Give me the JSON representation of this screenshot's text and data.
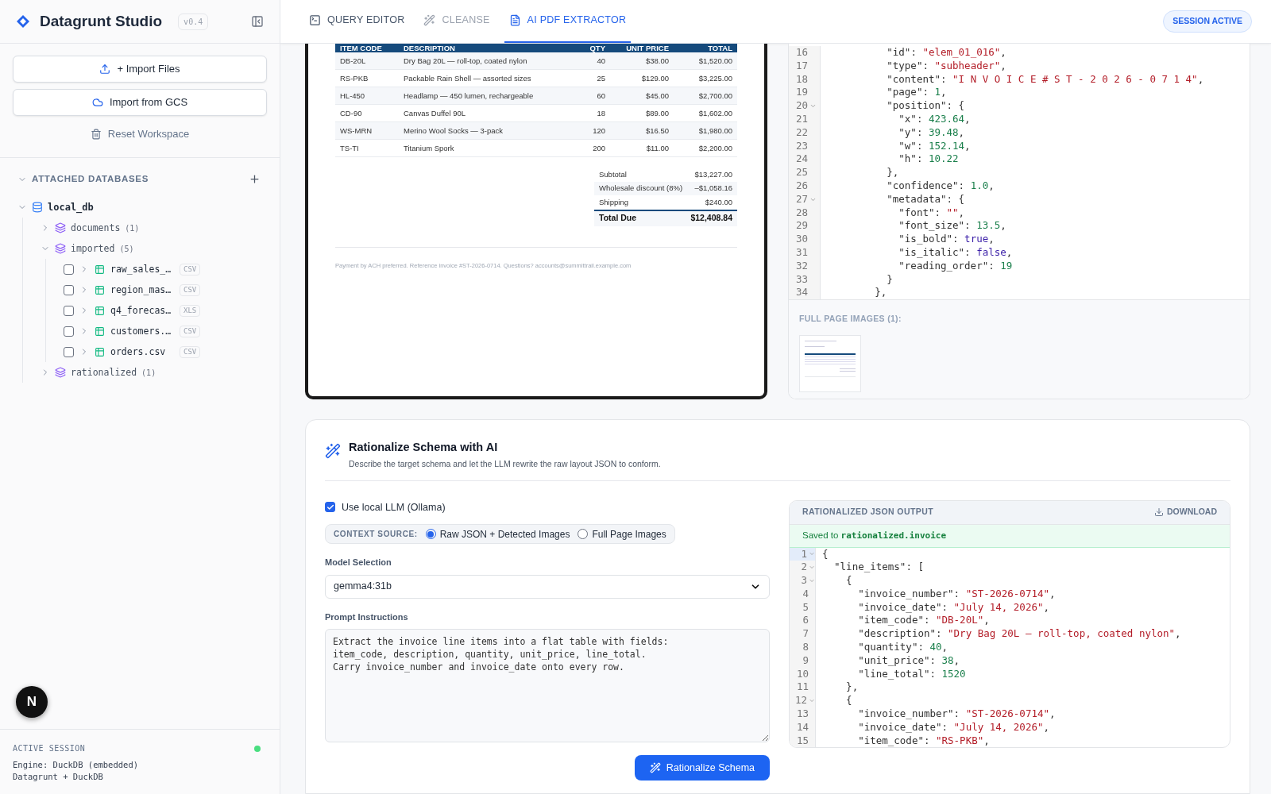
{
  "sidebar": {
    "brand": "Datagrunt Studio",
    "version": "v0.4",
    "actions": [
      {
        "kind": "primary",
        "label": "+ Import Files"
      },
      {
        "kind": "primary",
        "label": "Import from GCS"
      },
      {
        "kind": "plain",
        "label": "Reset Workspace"
      }
    ],
    "databases_title": "ATTACHED DATABASES",
    "databases_expanded": true,
    "tree": [
      {
        "kind": "database",
        "name": "local_db",
        "expanded": true,
        "children": [
          {
            "kind": "schema",
            "name": "documents",
            "count": "(1)",
            "expanded": false
          },
          {
            "kind": "schema",
            "name": "imported",
            "count": "(5)",
            "expanded": true,
            "children": [
              {
                "kind": "table",
                "name": "raw_sales_…",
                "badge": "CSV",
                "checked": false,
                "expanded": false
              },
              {
                "kind": "table",
                "name": "region_mas…",
                "badge": "CSV",
                "checked": false,
                "expanded": false
              },
              {
                "kind": "table",
                "name": "q4_forecas…",
                "badge": "XLS",
                "checked": false,
                "expanded": false
              },
              {
                "kind": "table",
                "name": "customers.…",
                "badge": "CSV",
                "checked": false,
                "expanded": false
              },
              {
                "kind": "table",
                "name": "orders.csv",
                "badge": "CSV",
                "checked": false,
                "expanded": false
              }
            ]
          },
          {
            "kind": "schema",
            "name": "rationalized",
            "count": "(1)",
            "expanded": false
          }
        ]
      }
    ],
    "footer": {
      "title": "ACTIVE SESSION",
      "online": true,
      "lines": [
        "Engine: DuckDB (embedded)",
        "Datagrunt + DuckDB"
      ]
    },
    "overlay_badge": "N"
  },
  "tabs": [
    {
      "label": "QUERY EDITOR",
      "kind": "terminal",
      "selected": false,
      "disabled": false
    },
    {
      "label": "CLEANSE",
      "kind": "wand",
      "selected": false,
      "disabled": true
    },
    {
      "label": "AI PDF EXTRACTOR",
      "kind": "document",
      "selected": true,
      "disabled": false
    }
  ],
  "session_badge": "SESSION ACTIVE",
  "pdf": {
    "columns": [
      "ITEM CODE",
      "DESCRIPTION",
      "QTY",
      "UNIT PRICE",
      "TOTAL"
    ],
    "rows": [
      [
        "DB-20L",
        "Dry Bag 20L — roll-top, coated nylon",
        "40",
        "$38.00",
        "$1,520.00"
      ],
      [
        "RS-PKB",
        "Packable Rain Shell — assorted sizes",
        "25",
        "$129.00",
        "$3,225.00"
      ],
      [
        "HL-450",
        "Headlamp — 450 lumen, rechargeable",
        "60",
        "$45.00",
        "$2,700.00"
      ],
      [
        "CD-90",
        "Canvas Duffel 90L",
        "18",
        "$89.00",
        "$1,602.00"
      ],
      [
        "WS-MRN",
        "Merino Wool Socks — 3-pack",
        "120",
        "$16.50",
        "$1,980.00"
      ],
      [
        "TS-TI",
        "Titanium Spork",
        "200",
        "$11.00",
        "$2,200.00"
      ]
    ],
    "totals": [
      {
        "label": "Subtotal",
        "value": "$13,227.00",
        "kind": "line"
      },
      {
        "label": "Wholesale discount (8%)",
        "value": "–$1,058.16",
        "kind": "line"
      },
      {
        "label": "Shipping",
        "value": "$240.00",
        "kind": "line"
      },
      {
        "label": "Total Due",
        "value": "$12,408.84",
        "kind": "total"
      }
    ],
    "note": "Payment by ACH preferred. Reference invoice #ST-2026-0714. Questions? accounts@summittrail.example.com"
  },
  "raw_json": {
    "lines": [
      {
        "n": "16",
        "fold": false,
        "text": "          \"id\": \"elem_01_016\","
      },
      {
        "n": "17",
        "fold": false,
        "text": "          \"type\": \"subheader\","
      },
      {
        "n": "18",
        "fold": false,
        "text": "          \"content\": \"I N V O I C E # S T - 2 0 2 6 - 0 7 1 4\","
      },
      {
        "n": "19",
        "fold": false,
        "text": "          \"page\": 1,"
      },
      {
        "n": "20",
        "fold": true,
        "text": "          \"position\": {"
      },
      {
        "n": "21",
        "fold": false,
        "text": "            \"x\": 423.64,"
      },
      {
        "n": "22",
        "fold": false,
        "text": "            \"y\": 39.48,"
      },
      {
        "n": "23",
        "fold": false,
        "text": "            \"w\": 152.14,"
      },
      {
        "n": "24",
        "fold": false,
        "text": "            \"h\": 10.22"
      },
      {
        "n": "25",
        "fold": false,
        "text": "          },"
      },
      {
        "n": "26",
        "fold": false,
        "text": "          \"confidence\": 1.0,"
      },
      {
        "n": "27",
        "fold": true,
        "text": "          \"metadata\": {"
      },
      {
        "n": "28",
        "fold": false,
        "text": "            \"font\": \"\","
      },
      {
        "n": "29",
        "fold": false,
        "text": "            \"font_size\": 13.5,"
      },
      {
        "n": "30",
        "fold": false,
        "text": "            \"is_bold\": true,"
      },
      {
        "n": "31",
        "fold": false,
        "text": "            \"is_italic\": false,"
      },
      {
        "n": "32",
        "fold": false,
        "text": "            \"reading_order\": 19"
      },
      {
        "n": "33",
        "fold": false,
        "text": "          }"
      },
      {
        "n": "34",
        "fold": false,
        "text": "        },"
      }
    ],
    "images_title": "FULL PAGE IMAGES (1):"
  },
  "rationalize": {
    "title": "Rationalize Schema with AI",
    "subtitle": "Describe the target schema and let the LLM rewrite the raw layout JSON to conform.",
    "use_local": {
      "label": "Use local LLM (Ollama)",
      "checked": true
    },
    "context_label": "CONTEXT SOURCE:",
    "context_options": [
      {
        "label": "Raw JSON + Detected Images",
        "selected": true
      },
      {
        "label": "Full Page Images",
        "selected": false
      }
    ],
    "model_label": "Model Selection",
    "model_value": "gemma4:31b",
    "prompt_label": "Prompt Instructions",
    "prompt_value": "Extract the invoice line items into a flat table with fields:\nitem_code, description, quantity, unit_price, line_total.\nCarry invoice_number and invoice_date onto every row.",
    "button": "Rationalize Schema",
    "output": {
      "title": "RATIONALIZED JSON OUTPUT",
      "download": "DOWNLOAD",
      "saved_prefix": "Saved to",
      "saved_target": "rationalized.invoice",
      "lines": [
        {
          "n": "1",
          "fold": true,
          "active": true,
          "text": "{"
        },
        {
          "n": "2",
          "fold": true,
          "active": false,
          "text": "  \"line_items\": ["
        },
        {
          "n": "3",
          "fold": true,
          "active": false,
          "text": "    {"
        },
        {
          "n": "4",
          "fold": false,
          "active": false,
          "text": "      \"invoice_number\": \"ST-2026-0714\","
        },
        {
          "n": "5",
          "fold": false,
          "active": false,
          "text": "      \"invoice_date\": \"July 14, 2026\","
        },
        {
          "n": "6",
          "fold": false,
          "active": false,
          "text": "      \"item_code\": \"DB-20L\","
        },
        {
          "n": "7",
          "fold": false,
          "active": false,
          "text": "      \"description\": \"Dry Bag 20L — roll-top, coated nylon\","
        },
        {
          "n": "8",
          "fold": false,
          "active": false,
          "text": "      \"quantity\": 40,"
        },
        {
          "n": "9",
          "fold": false,
          "active": false,
          "text": "      \"unit_price\": 38,"
        },
        {
          "n": "10",
          "fold": false,
          "active": false,
          "text": "      \"line_total\": 1520"
        },
        {
          "n": "11",
          "fold": false,
          "active": false,
          "text": "    },"
        },
        {
          "n": "12",
          "fold": true,
          "active": false,
          "text": "    {"
        },
        {
          "n": "13",
          "fold": false,
          "active": false,
          "text": "      \"invoice_number\": \"ST-2026-0714\","
        },
        {
          "n": "14",
          "fold": false,
          "active": false,
          "text": "      \"invoice_date\": \"July 14, 2026\","
        },
        {
          "n": "15",
          "fold": false,
          "active": false,
          "text": "      \"item_code\": \"RS-PKB\","
        }
      ]
    }
  }
}
